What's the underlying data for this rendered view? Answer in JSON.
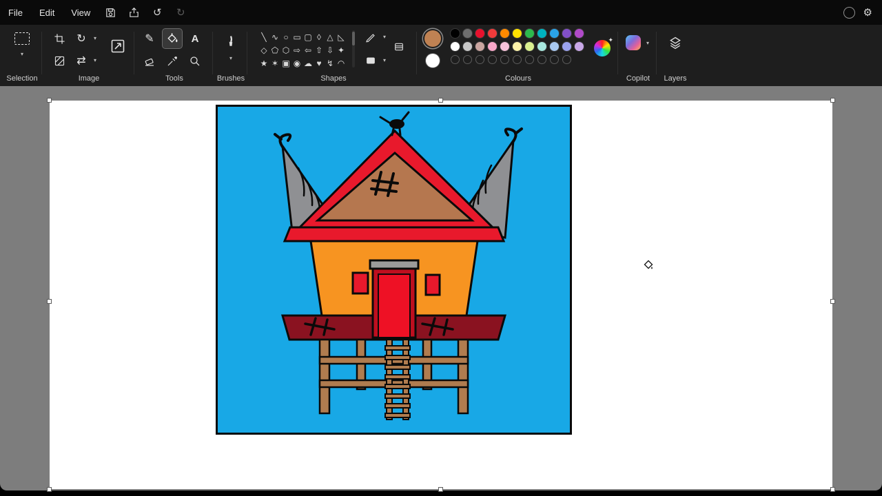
{
  "menu": {
    "file": "File",
    "edit": "Edit",
    "view": "View"
  },
  "toolbar": {
    "labels": {
      "selection": "Selection",
      "image": "Image",
      "tools": "Tools",
      "brushes": "Brushes",
      "shapes": "Shapes",
      "colours": "Colours",
      "copilot": "Copilot",
      "layers": "Layers"
    },
    "text_tool_label": "A"
  },
  "shapes": {
    "glyphs": [
      {
        "glyph": "╲",
        "name": "shape-line"
      },
      {
        "glyph": "∿",
        "name": "shape-curve"
      },
      {
        "glyph": "○",
        "name": "shape-oval"
      },
      {
        "glyph": "▭",
        "name": "shape-rectangle"
      },
      {
        "glyph": "▢",
        "name": "shape-rounded-rectangle"
      },
      {
        "glyph": "◊",
        "name": "shape-polygon"
      },
      {
        "glyph": "△",
        "name": "shape-triangle"
      },
      {
        "glyph": "◺",
        "name": "shape-right-triangle"
      },
      {
        "glyph": "◇",
        "name": "shape-diamond"
      },
      {
        "glyph": "⬠",
        "name": "shape-pentagon"
      },
      {
        "glyph": "⬡",
        "name": "shape-hexagon"
      },
      {
        "glyph": "⇨",
        "name": "shape-right-arrow"
      },
      {
        "glyph": "⇦",
        "name": "shape-left-arrow"
      },
      {
        "glyph": "⇧",
        "name": "shape-up-arrow"
      },
      {
        "glyph": "⇩",
        "name": "shape-down-arrow"
      },
      {
        "glyph": "✦",
        "name": "shape-four-point-star"
      },
      {
        "glyph": "★",
        "name": "shape-five-point-star"
      },
      {
        "glyph": "✶",
        "name": "shape-six-point-star"
      },
      {
        "glyph": "▣",
        "name": "shape-rectangular-callout"
      },
      {
        "glyph": "◉",
        "name": "shape-oval-callout"
      },
      {
        "glyph": "☁",
        "name": "shape-cloud-callout"
      },
      {
        "glyph": "♥",
        "name": "shape-heart"
      },
      {
        "glyph": "↯",
        "name": "shape-lightning"
      },
      {
        "glyph": "◠",
        "name": "shape-arc"
      }
    ]
  },
  "colours": {
    "colour1": "#c08253",
    "colour2": "#ffffff",
    "row1": [
      "#000000",
      "#6e6e6e",
      "#e8112d",
      "#f03b3b",
      "#ff8a00",
      "#ffe200",
      "#2db84d",
      "#00b3bf",
      "#2aa3e8",
      "#8250c9",
      "#b04ac9"
    ],
    "row2": [
      "#ffffff",
      "#c8c8c8",
      "#caa5a0",
      "#f9a8c9",
      "#f7c3da",
      "#fdf3a9",
      "#d9ef8f",
      "#a8e8df",
      "#a8c8f0",
      "#9aa2ee",
      "#c9a8e8"
    ],
    "empty_slots": 10
  },
  "drawing": {
    "sky": "#18a8e6",
    "roof_red": "#e8192c",
    "roof_brown": "#b5774f",
    "side_roof_gray": "#8f9093",
    "body_orange": "#f79421",
    "door_frame": "#bf0f1f",
    "door": "#ee1125",
    "lintel": "#9b9b9b",
    "window_red": "#e8192c",
    "platform_maroon": "#8a1220",
    "wood_tan": "#b07c4f",
    "outline": "#0a0a0a"
  }
}
